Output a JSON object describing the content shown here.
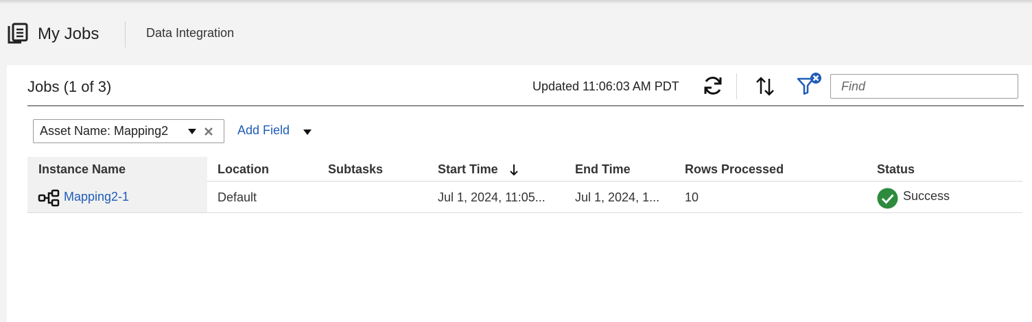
{
  "header": {
    "title": "My Jobs",
    "subtitle": "Data Integration",
    "icon": "jobs-icon"
  },
  "toolbar": {
    "jobs_title": "Jobs (1 of 3)",
    "updated": "Updated 11:06:03 AM PDT",
    "refresh_icon": "refresh-icon",
    "sort_icon": "sort-icon",
    "filter_icon": "clear-filter-icon",
    "find_placeholder": "Find",
    "find_value": ""
  },
  "filters": {
    "chip_label": "Asset Name: Mapping2",
    "add_field": "Add Field"
  },
  "table": {
    "columns": [
      "Instance Name",
      "Location",
      "Subtasks",
      "Start Time",
      "End Time",
      "Rows Processed",
      "Status"
    ],
    "sorted_column": "Start Time",
    "sort_direction": "descending",
    "rows": [
      {
        "instance_name": "Mapping2-1",
        "location": "Default",
        "subtasks": "",
        "start_time": "Jul 1, 2024, 11:05...",
        "end_time": "Jul 1, 2024, 1...",
        "rows_processed": "10",
        "status": "Success"
      }
    ]
  },
  "colors": {
    "link": "#1f5cb8",
    "success": "#2e8b3e",
    "filter_icon": "#1f5cb8"
  }
}
